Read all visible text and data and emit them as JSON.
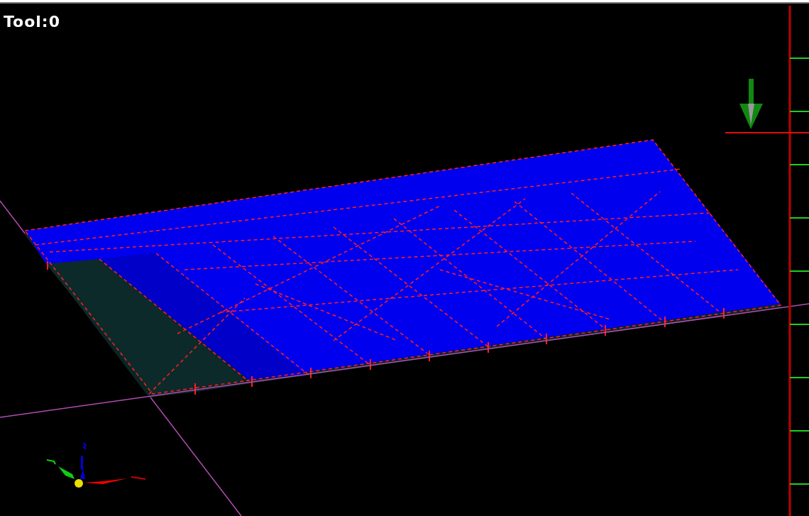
{
  "viewport": {
    "tool_label": "Tool:0"
  }
}
